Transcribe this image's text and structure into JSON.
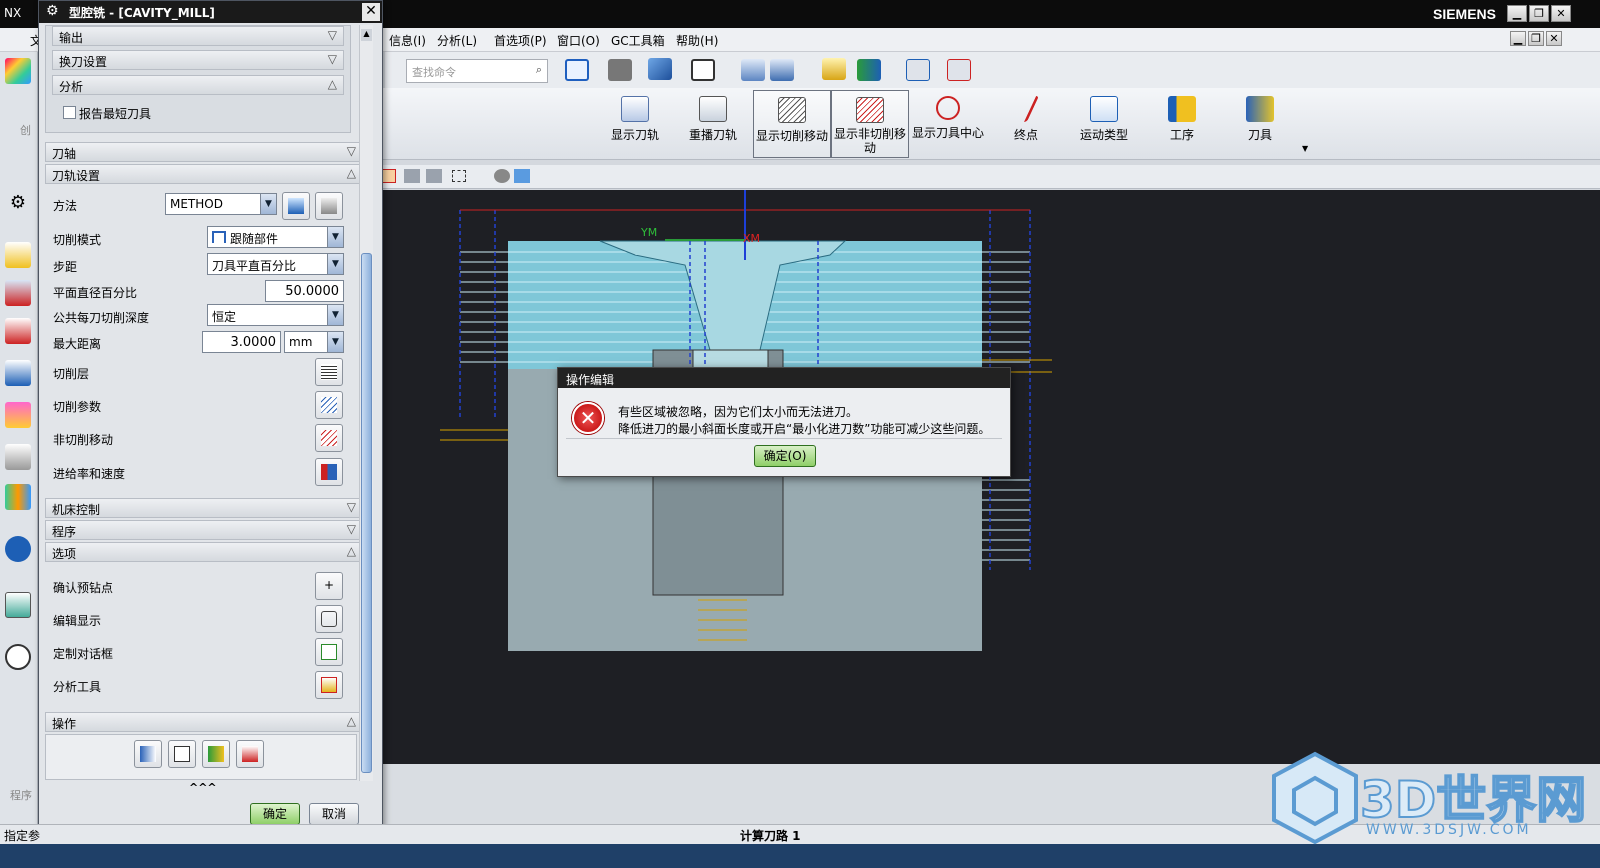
{
  "window": {
    "app_tab": "NX",
    "brand": "SIEMENS",
    "controls": [
      "▁",
      "❐",
      "✕"
    ]
  },
  "menu": [
    "信息(I)",
    "分析(L)",
    "首选项(P)",
    "窗口(O)",
    "GC工具箱",
    "帮助(H)"
  ],
  "search": {
    "placeholder": "查找命令"
  },
  "ribbon": [
    "显示刀轨",
    "重播刀轨",
    "显示切削移动",
    "显示非切削移动",
    "显示刀具中心",
    "终点",
    "运动类型",
    "工序",
    "刀具"
  ],
  "left_fragment": {
    "file": "文",
    "create": "创",
    "program": "程序",
    "status": "指定参"
  },
  "dialog": {
    "title": "型腔铣 - [CAVITY_MILL]",
    "sections": {
      "output": "输出",
      "tool_change": "换刀设置",
      "analysis": "分析",
      "tool_axis": "刀轴",
      "path_settings": "刀轨设置",
      "machine_control": "机床控制",
      "program": "程序",
      "options": "选项",
      "actions": "操作"
    },
    "report_shortest_tool": "报告最短刀具",
    "method_label": "方法",
    "method_value": "METHOD",
    "cut_pattern_label": "切削模式",
    "cut_pattern_value": "跟随部件",
    "stepover_label": "步距",
    "stepover_value": "刀具平直百分比",
    "flat_pct_label": "平面直径百分比",
    "flat_pct_value": "50.0000",
    "depth_label": "公共每刀切削深度",
    "depth_value": "恒定",
    "max_dist_label": "最大距离",
    "max_dist_value": "3.0000",
    "max_dist_unit": "mm",
    "cut_levels": "切削层",
    "cut_params": "切削参数",
    "non_cut": "非切削移动",
    "feeds": "进给率和速度",
    "confirm_pre_drill": "确认预钻点",
    "edit_display": "编辑显示",
    "custom_dialog": "定制对话框",
    "analysis_tool": "分析工具",
    "more": "^^^",
    "ok": "确定",
    "cancel": "取消"
  },
  "error": {
    "title": "操作编辑",
    "line1": "有些区域被忽略，因为它们太小而无法进刀。",
    "line2": "降低进刀的最小斜面长度或开启“最小化进刀数”功能可减少这些问题。",
    "ok": "确定(O)"
  },
  "viewport": {
    "ym": "YM",
    "xm": "XM"
  },
  "status": {
    "center": "计算刀路 1"
  },
  "watermark": {
    "text": "3D世界网",
    "url": "WWW.3DSJW.COM"
  },
  "colors": {
    "model": "#7fc7d8",
    "mold": "#98aab0",
    "dark": "#1e1f24",
    "accent": "#1b5fb1"
  }
}
